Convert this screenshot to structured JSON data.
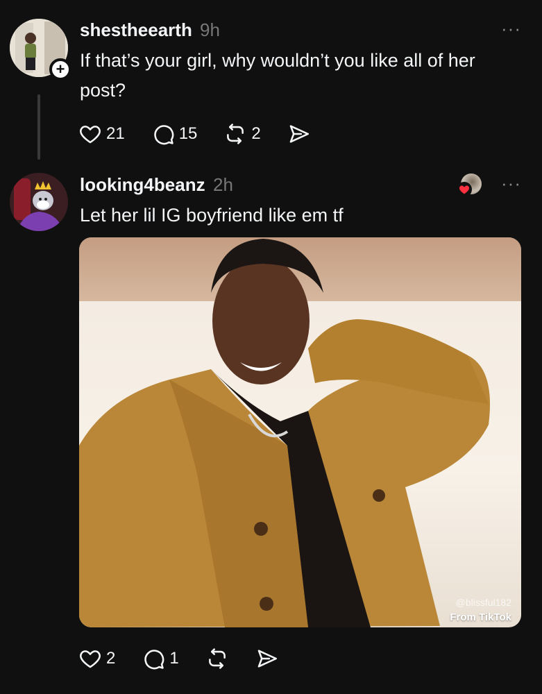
{
  "posts": [
    {
      "username": "shestheearth",
      "time": "9h",
      "text": "If that’s your girl, why wouldn’t you like all of her post?",
      "likes": "21",
      "replies": "15",
      "reposts": "2",
      "more": "···"
    },
    {
      "username": "looking4beanz",
      "time": "2h",
      "text": "Let her lil IG boyfriend like em tf",
      "likes": "2",
      "replies": "1",
      "more": "···",
      "media": {
        "watermark": "From TikTok",
        "handle": "@blissful182"
      }
    }
  ],
  "follow_badge": "+",
  "icons": {
    "like": "heart-icon",
    "reply": "comment-icon",
    "repost": "repost-icon",
    "share": "send-icon"
  },
  "colors": {
    "background": "#101010",
    "text": "#f3f5f7",
    "muted": "#777777",
    "liked_heart": "#ff3040"
  }
}
